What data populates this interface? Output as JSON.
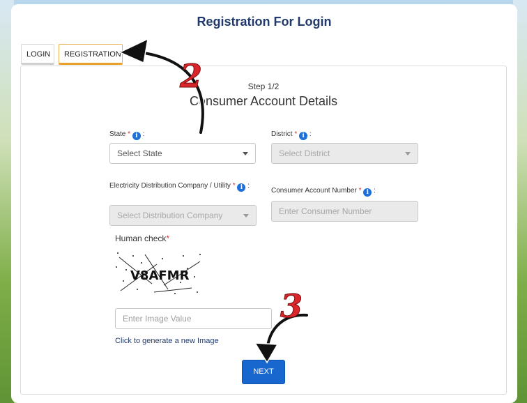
{
  "page": {
    "title": "Registration For Login"
  },
  "tabs": [
    {
      "label": "LOGIN"
    },
    {
      "label": "REGISTRATION"
    }
  ],
  "form": {
    "step": "Step 1/2",
    "heading": "Consumer Account Details",
    "state": {
      "label": "State",
      "required_mark": "*",
      "suffix": ":",
      "value": "Select State"
    },
    "district": {
      "label": "District",
      "required_mark": "*",
      "suffix": ":",
      "value": "Select District"
    },
    "utility": {
      "label": "Electricity Distribution Company / Utility",
      "required_mark": "*",
      "suffix": ":",
      "value": "Select Distribution Company"
    },
    "account": {
      "label": "Consumer Account Number",
      "required_mark": "*",
      "suffix": ":",
      "placeholder": "Enter Consumer Number"
    },
    "human_check": {
      "label": "Human check",
      "required_mark": "*",
      "captcha_text": "V8AFMR",
      "input_placeholder": "Enter Image Value",
      "regenerate_link": "Click to generate a new Image"
    },
    "next_label": "NEXT"
  },
  "annotations": {
    "marker_2": "2",
    "marker_3": "3"
  },
  "colors": {
    "primary": "#1767cf",
    "title": "#213a6b",
    "required": "#d32f2f",
    "tab_highlight": "#e9a02c",
    "annotation": "#d8262a"
  },
  "icons": {
    "info": "info-icon",
    "caret": "chevron-down-icon"
  }
}
